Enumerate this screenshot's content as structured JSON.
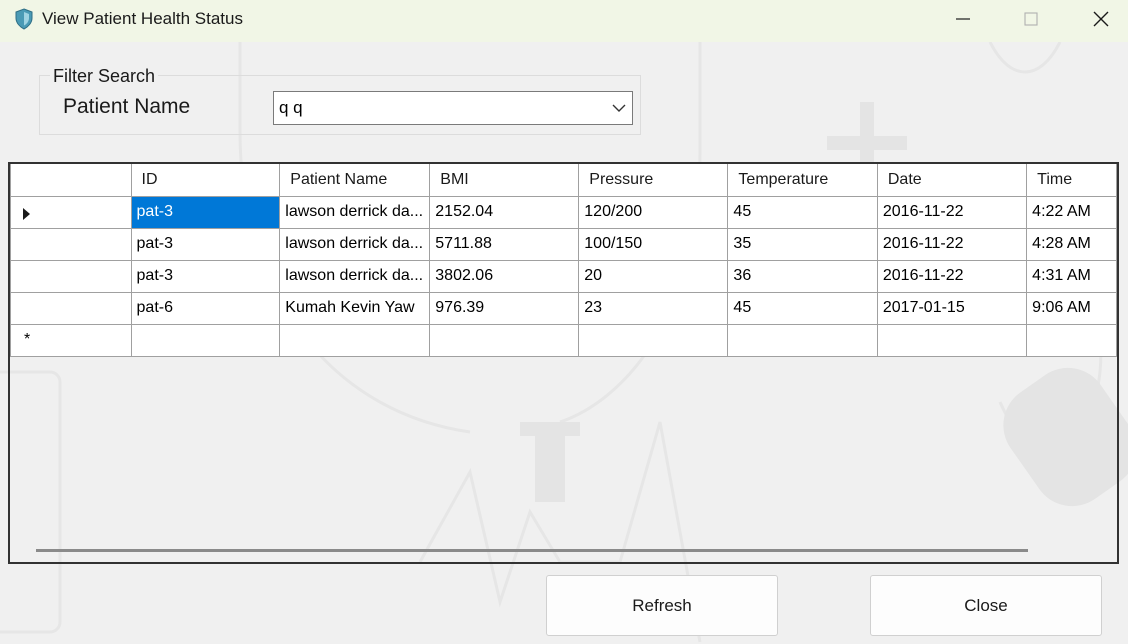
{
  "window": {
    "title": "View Patient Health Status",
    "icon": "shield-icon",
    "controls": [
      "minimize-icon",
      "maximize-icon",
      "close-icon"
    ]
  },
  "filter": {
    "group_title": "Filter Search",
    "patient_label": "Patient Name",
    "patient_value": "q q"
  },
  "grid": {
    "columns": [
      "ID",
      "Patient Name",
      "BMI",
      "Pressure",
      "Temperature",
      "Date",
      "Time"
    ],
    "rows": [
      [
        "pat-3",
        "lawson derrick da...",
        "2152.04",
        "120/200",
        "45",
        "2016-11-22",
        "4:22 AM"
      ],
      [
        "pat-3",
        "lawson derrick da...",
        "5711.88",
        "100/150",
        "35",
        "2016-11-22",
        "4:28 AM"
      ],
      [
        "pat-3",
        "lawson derrick da...",
        "3802.06",
        "20",
        "36",
        "2016-11-22",
        "4:31 AM"
      ],
      [
        "pat-6",
        "Kumah Kevin Yaw",
        "976.39",
        "23",
        "45",
        "2017-01-15",
        "9:06 AM"
      ]
    ],
    "new_row_marker": "*"
  },
  "buttons": {
    "refresh": "Refresh",
    "close": "Close"
  },
  "colors": {
    "titlebar": "#f1f6e6",
    "selection": "#0078d7",
    "window_bg": "#f0f0f0"
  }
}
